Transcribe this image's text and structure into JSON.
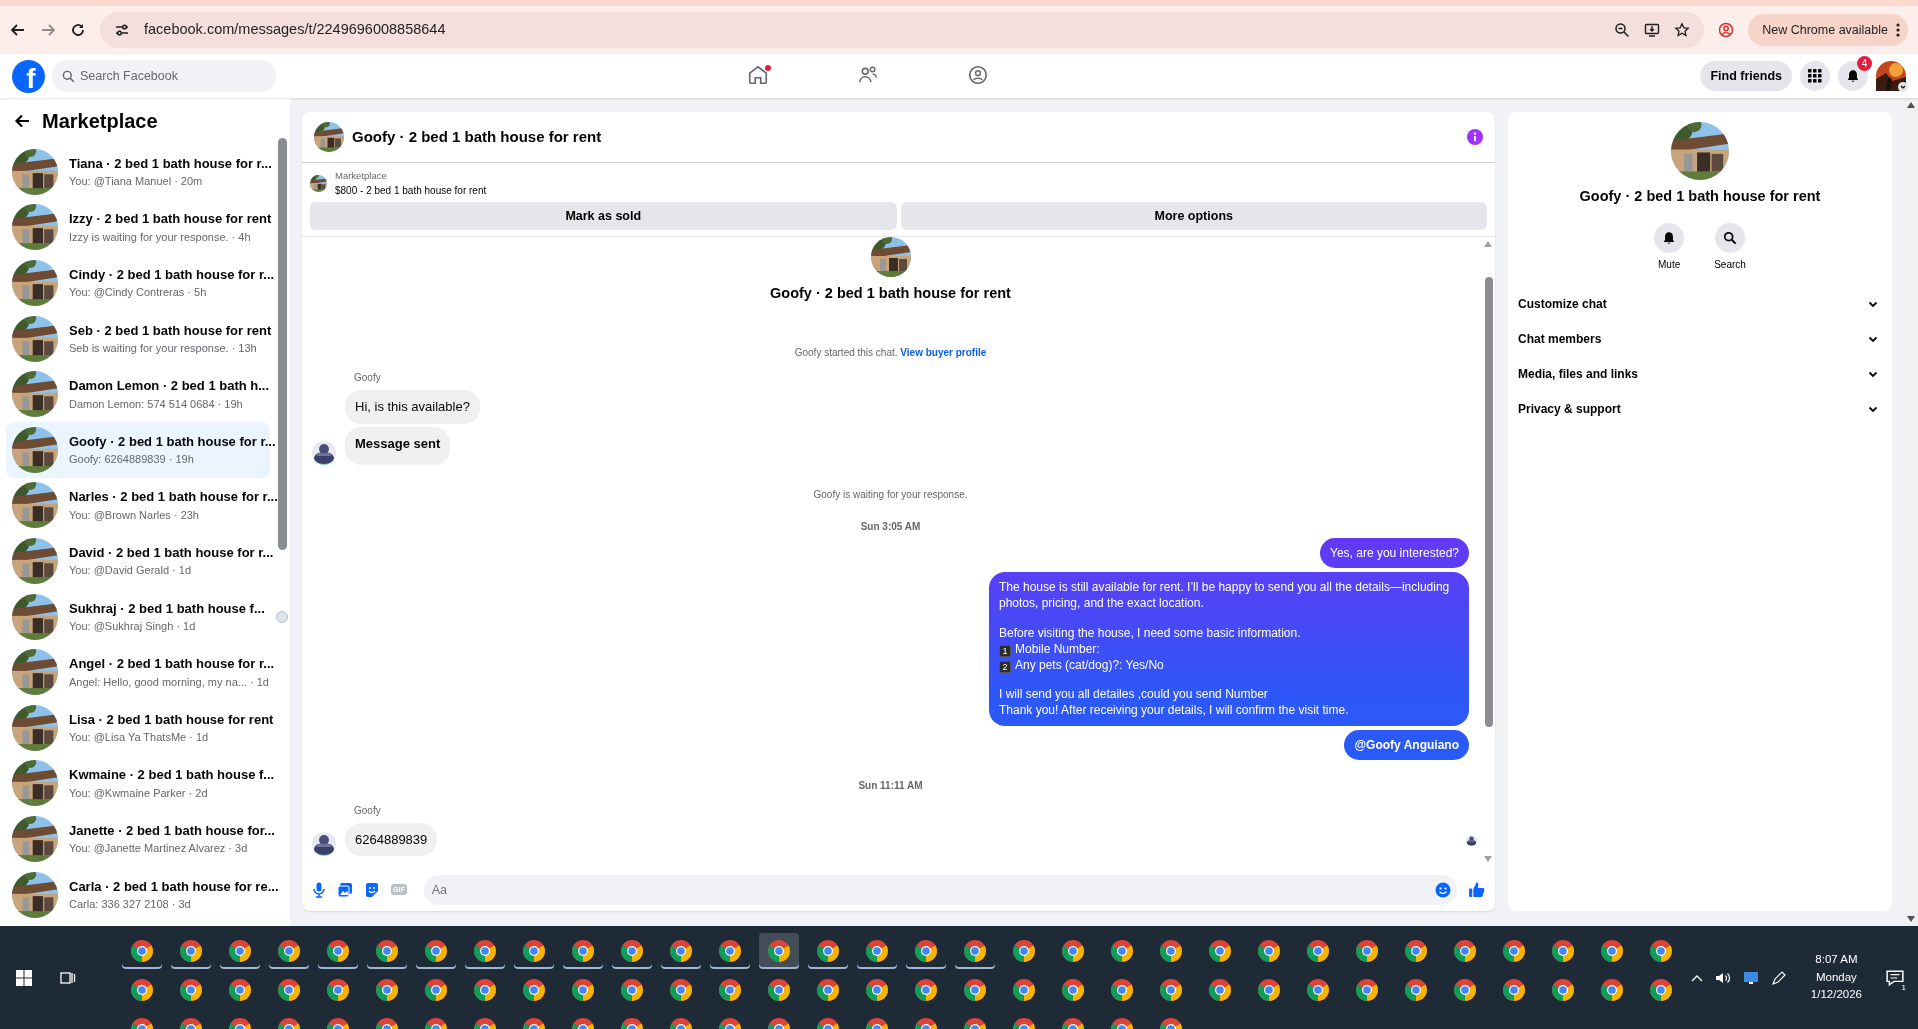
{
  "browser": {
    "url": "facebook.com/messages/t/2249696008858644",
    "update_button": "New Chrome available"
  },
  "topnav": {
    "logo_letter": "f",
    "search": {
      "placeholder": "Search Facebook"
    },
    "tabs": [
      {
        "kind": "home",
        "selected": false,
        "notification": true
      },
      {
        "kind": "friends",
        "selected": false,
        "notification": false
      },
      {
        "kind": "groups",
        "selected": false,
        "notification": false
      }
    ],
    "find_friends": "Find friends",
    "notification_count": "4"
  },
  "sidebar": {
    "title": "Marketplace",
    "conversations": [
      {
        "title": "Tiana · 2 bed 1 bath house for r...",
        "preview": "You: @Tiana Manuel · 20m",
        "selected": false,
        "seen_avatar": false
      },
      {
        "title": "Izzy · 2 bed 1 bath house for rent",
        "preview": "Izzy is waiting for your response. · 4h",
        "selected": false,
        "seen_avatar": false
      },
      {
        "title": "Cindy · 2 bed 1 bath house for r...",
        "preview": "You: @Cindy Contreras · 5h",
        "selected": false,
        "seen_avatar": false
      },
      {
        "title": "Seb · 2 bed 1 bath house for rent",
        "preview": "Seb is waiting for your response. · 13h",
        "selected": false,
        "seen_avatar": false
      },
      {
        "title": "Damon Lemon · 2 bed 1 bath h...",
        "preview": "Damon Lemon: 574 514 0684 · 19h",
        "selected": false,
        "seen_avatar": false
      },
      {
        "title": "Goofy · 2 bed 1 bath house for r...",
        "preview": "Goofy: 6264889839 · 19h",
        "selected": true,
        "seen_avatar": false
      },
      {
        "title": "Narles · 2 bed 1 bath house for r...",
        "preview": "You: @Brown Narles · 23h",
        "selected": false,
        "seen_avatar": false
      },
      {
        "title": "David · 2 bed 1 bath house for r...",
        "preview": "You: @David Gerald · 1d",
        "selected": false,
        "seen_avatar": false
      },
      {
        "title": "Sukhraj · 2 bed 1 bath house f...",
        "preview": "You: @Sukhraj Singh · 1d",
        "selected": false,
        "seen_avatar": true
      },
      {
        "title": "Angel · 2 bed 1 bath house for r...",
        "preview": "Angel: Hello, good morning, my na... · 1d",
        "selected": false,
        "seen_avatar": false
      },
      {
        "title": "Lisa · 2 bed 1 bath house for rent",
        "preview": "You: @Lisa Ya ThatsMe · 1d",
        "selected": false,
        "seen_avatar": false
      },
      {
        "title": "Kwmaine · 2 bed 1 bath house f...",
        "preview": "You: @Kwmaine Parker · 2d",
        "selected": false,
        "seen_avatar": false
      },
      {
        "title": "Janette · 2 bed 1 bath house for...",
        "preview": "You: @Janette Martinez Alvarez · 3d",
        "selected": false,
        "seen_avatar": false
      },
      {
        "title": "Carla · 2 bed 1 bath house for re...",
        "preview": "Carla: 336 327 2108 · 3d",
        "selected": false,
        "seen_avatar": false
      }
    ]
  },
  "chat": {
    "title": "Goofy · 2 bed 1 bath house for rent",
    "listing": {
      "label": "Marketplace",
      "description": "$800 - 2 bed 1 bath house for rent"
    },
    "actions": [
      "Mark as sold",
      "More options"
    ],
    "messages": [
      {
        "kind": "profile",
        "text": "Goofy · 2 bed 1 bath house for rent"
      },
      {
        "kind": "system",
        "text": "Goofy started this chat.",
        "link": "View buyer profile"
      },
      {
        "kind": "sender",
        "text": "Goofy"
      },
      {
        "kind": "incoming",
        "text": "Hi, is this available?",
        "bold": false,
        "avatar": false
      },
      {
        "kind": "incoming",
        "text": "Message sent",
        "bold": true,
        "avatar": true
      },
      {
        "kind": "system",
        "text": "Goofy is waiting for your response."
      },
      {
        "kind": "timestamp",
        "text": "Sun 3:05 AM"
      },
      {
        "kind": "outgoing",
        "bold": false,
        "paragraphs": [
          {
            "lines": [
              {
                "text": "Yes, are you interested?"
              }
            ]
          }
        ]
      },
      {
        "kind": "outgoing",
        "bold": false,
        "paragraphs": [
          {
            "lines": [
              {
                "text": "The house is still available for rent. I’ll be happy to send you all the details—including photos, pricing, and the exact location."
              }
            ]
          },
          {
            "lines": [
              {
                "text": "Before visiting the house, I need some basic information."
              },
              {
                "number": "1",
                "text": "Mobile Number:"
              },
              {
                "number": "2",
                "text": "Any pets (cat/dog)?: Yes/No"
              }
            ]
          },
          {
            "lines": [
              {
                "text": "I will send you all detailes ,could you send Number"
              },
              {
                "text": "Thank you! After receiving your details, I will confirm the visit time."
              }
            ]
          }
        ]
      },
      {
        "kind": "outgoing",
        "bold": true,
        "paragraphs": [
          {
            "lines": [
              {
                "text": "@Goofy Anguiano"
              }
            ]
          }
        ]
      },
      {
        "kind": "timestamp",
        "text": "Sun 11:11 AM"
      },
      {
        "kind": "sender",
        "text": "Goofy"
      },
      {
        "kind": "incoming",
        "text": "6264889839",
        "bold": false,
        "avatar": true
      }
    ],
    "composer": {
      "gif": "GIF",
      "placeholder": "Aa"
    }
  },
  "details": {
    "title": "Goofy · 2 bed 1 bath house for rent",
    "actions": [
      {
        "kind": "mute",
        "label": "Mute"
      },
      {
        "kind": "search",
        "label": "Search"
      }
    ],
    "sections": [
      {
        "label": "Customize chat",
        "expanded": false
      },
      {
        "label": "Chat members",
        "expanded": false
      },
      {
        "label": "Media, files and links",
        "expanded": false
      },
      {
        "label": "Privacy & support",
        "expanded": false
      }
    ]
  },
  "taskbar": {
    "rows": [
      [
        {
          "running": true,
          "selected": false
        },
        {
          "running": true,
          "selected": false
        },
        {
          "running": true,
          "selected": false
        },
        {
          "running": true,
          "selected": false
        },
        {
          "running": true,
          "selected": false
        },
        {
          "running": true,
          "selected": false
        },
        {
          "running": true,
          "selected": false
        },
        {
          "running": true,
          "selected": false
        },
        {
          "running": true,
          "selected": false
        },
        {
          "running": true,
          "selected": false
        },
        {
          "running": true,
          "selected": false
        },
        {
          "running": true,
          "selected": false
        },
        {
          "running": true,
          "selected": false
        },
        {
          "running": true,
          "selected": true
        },
        {
          "running": true,
          "selected": false
        },
        {
          "running": true,
          "selected": false
        },
        {
          "running": true,
          "selected": false
        },
        {
          "running": true,
          "selected": false
        },
        {
          "running": false,
          "selected": false
        },
        {
          "running": false,
          "selected": false
        },
        {
          "running": false,
          "selected": false
        },
        {
          "running": false,
          "selected": false
        },
        {
          "running": false,
          "selected": false
        },
        {
          "running": false,
          "selected": false
        },
        {
          "running": false,
          "selected": false
        },
        {
          "running": false,
          "selected": false
        },
        {
          "running": false,
          "selected": false
        },
        {
          "running": false,
          "selected": false
        },
        {
          "running": false,
          "selected": false
        },
        {
          "running": false,
          "selected": false
        },
        {
          "running": false,
          "selected": false
        },
        {
          "running": false,
          "selected": false
        }
      ],
      [
        {
          "running": false,
          "selected": false
        },
        {
          "running": false,
          "selected": false
        },
        {
          "running": false,
          "selected": false
        },
        {
          "running": false,
          "selected": false
        },
        {
          "running": false,
          "selected": false
        },
        {
          "running": false,
          "selected": false
        },
        {
          "running": false,
          "selected": false
        },
        {
          "running": false,
          "selected": false
        },
        {
          "running": false,
          "selected": false
        },
        {
          "running": false,
          "selected": false
        },
        {
          "running": false,
          "selected": false
        },
        {
          "running": false,
          "selected": false
        },
        {
          "running": false,
          "selected": false
        },
        {
          "running": false,
          "selected": false
        },
        {
          "running": false,
          "selected": false
        },
        {
          "running": false,
          "selected": false
        },
        {
          "running": false,
          "selected": false
        },
        {
          "running": false,
          "selected": false
        },
        {
          "running": false,
          "selected": false
        },
        {
          "running": false,
          "selected": false
        },
        {
          "running": false,
          "selected": false
        },
        {
          "running": false,
          "selected": false
        },
        {
          "running": false,
          "selected": false
        },
        {
          "running": false,
          "selected": false
        },
        {
          "running": false,
          "selected": false
        },
        {
          "running": false,
          "selected": false
        },
        {
          "running": false,
          "selected": false
        },
        {
          "running": false,
          "selected": false
        },
        {
          "running": false,
          "selected": false
        },
        {
          "running": false,
          "selected": false
        },
        {
          "running": false,
          "selected": false
        },
        {
          "running": false,
          "selected": false
        }
      ]
    ],
    "time": "8:07 AM",
    "day": "Monday",
    "date": "1/12/2026",
    "notification_count": "1"
  }
}
